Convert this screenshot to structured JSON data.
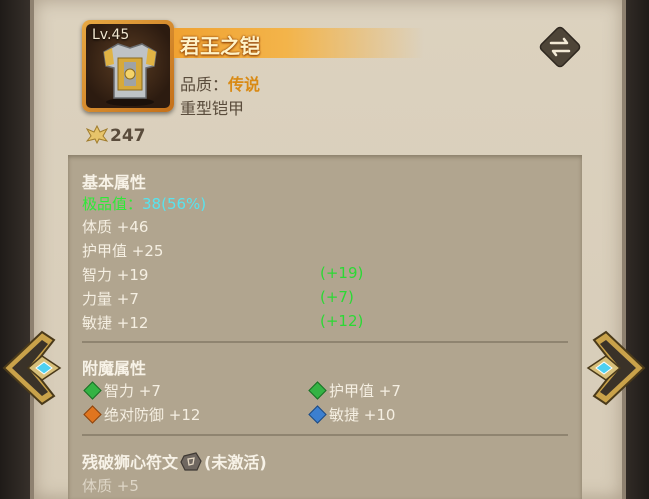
{
  "item": {
    "level": "Lv.45",
    "name": "君王之铠",
    "quality_label": "品质：",
    "quality_value": "传说",
    "type": "重型铠甲",
    "power": "247"
  },
  "colors": {
    "legendary": "#d98a14",
    "bonus_green": "#2bd934",
    "cyan": "#58e3ee",
    "gem_green": "#34b344",
    "gem_orange": "#e0751f",
    "gem_blue": "#3c7fd0"
  },
  "basic": {
    "heading": "基本属性",
    "best_label": "极品值：",
    "best_value": "38(56%)",
    "stats": [
      {
        "label": "体质 +46",
        "bonus": ""
      },
      {
        "label": "护甲值 +25",
        "bonus": ""
      },
      {
        "label": "智力 +19",
        "bonus": "(+19)"
      },
      {
        "label": "力量 +7",
        "bonus": "(+7)"
      },
      {
        "label": "敏捷 +12",
        "bonus": "(+12)"
      }
    ]
  },
  "enchant": {
    "heading": "附魔属性",
    "stats": [
      {
        "label": "智力 +7",
        "gem": "green"
      },
      {
        "label": "护甲值 +7",
        "gem": "green"
      },
      {
        "label": "绝对防御 +12",
        "gem": "orange"
      },
      {
        "label": "敏捷 +10",
        "gem": "blue"
      }
    ]
  },
  "rune": {
    "name": "残破狮心符文",
    "status": "(未激活)",
    "stat": "体质 +5"
  },
  "icons": {
    "swap": "swap-arrows-icon",
    "prev": "arrow-left-icon",
    "next": "arrow-right-icon",
    "power": "power-wings-icon",
    "armor": "armor-icon",
    "rune": "rune-stone-icon"
  }
}
